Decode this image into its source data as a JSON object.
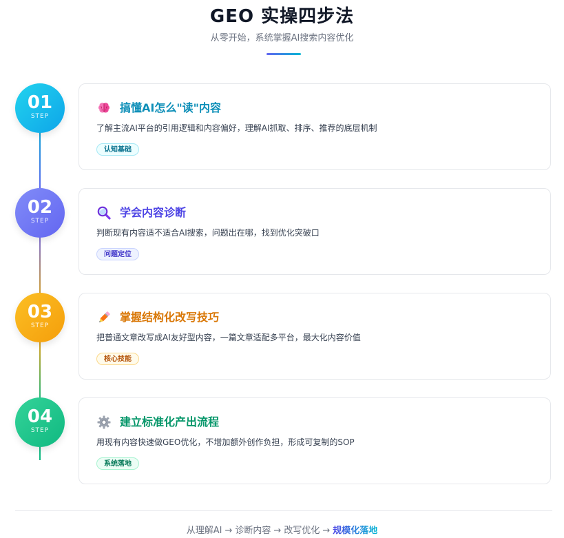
{
  "header": {
    "title": "GEO 实操四步法",
    "subtitle": "从零开始，系统掌握AI搜索内容优化"
  },
  "steps": [
    {
      "number": "01",
      "step_label": "STEP",
      "icon": "brain-icon",
      "title": "搞懂AI怎么\"读\"内容",
      "description": "了解主流AI平台的引用逻辑和内容偏好，理解AI抓取、排序、推荐的底层机制",
      "tag": "认知基础",
      "color": "#0ea5e9"
    },
    {
      "number": "02",
      "step_label": "STEP",
      "icon": "magnifier-icon",
      "title": "学会内容诊断",
      "description": "判断现有内容适不适合AI搜索，问题出在哪，找到优化突破口",
      "tag": "问题定位",
      "color": "#6366f1"
    },
    {
      "number": "03",
      "step_label": "STEP",
      "icon": "pencil-icon",
      "title": "掌握结构化改写技巧",
      "description": "把普通文章改写成AI友好型内容，一篇文章适配多平台，最大化内容价值",
      "tag": "核心技能",
      "color": "#f59e0b"
    },
    {
      "number": "04",
      "step_label": "STEP",
      "icon": "gear-icon",
      "title": "建立标准化产出流程",
      "description": "用现有内容快速做GEO优化，不增加额外创作负担，形成可复制的SOP",
      "tag": "系统落地",
      "color": "#10b981"
    }
  ],
  "footer": {
    "items": [
      "从理解AI",
      "诊断内容",
      "改写优化"
    ],
    "arrow": "→",
    "final": "规模化落地"
  }
}
